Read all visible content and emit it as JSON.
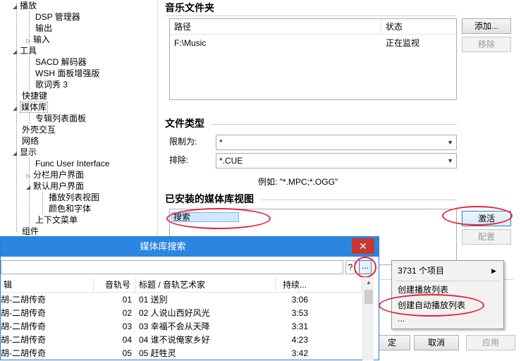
{
  "tree": {
    "items": [
      {
        "label": "播放"
      },
      {
        "label": "DSP 管理器"
      },
      {
        "label": "输出"
      },
      {
        "label": "输入"
      },
      {
        "label": "工具"
      },
      {
        "label": "SACD 解码器"
      },
      {
        "label": "WSH 面板增强版"
      },
      {
        "label": "歌词秀 3"
      },
      {
        "label": "快捷键"
      },
      {
        "label": "媒体库"
      },
      {
        "label": "专辑列表面板"
      },
      {
        "label": "外壳交互"
      },
      {
        "label": "网络"
      },
      {
        "label": "显示"
      },
      {
        "label": "Func User Interface"
      },
      {
        "label": "分栏用户界面"
      },
      {
        "label": "默认用户界面"
      },
      {
        "label": "播放列表视图"
      },
      {
        "label": "颜色和字体"
      },
      {
        "label": "上下文菜单"
      },
      {
        "label": "组件"
      }
    ]
  },
  "music_folders": {
    "title": "音乐文件夹",
    "col_path": "路径",
    "col_status": "状态",
    "rows": [
      {
        "path": "F:\\Music",
        "status": "正在监视"
      }
    ],
    "add_label": "添加...",
    "remove_label": "移除"
  },
  "file_types": {
    "title": "文件类型",
    "restrict_label": "限制为:",
    "restrict_value": "*",
    "exclude_label": "排除:",
    "exclude_value": "*.CUE",
    "example": "例如: \"*.MPC;*.OGG\""
  },
  "installed_views": {
    "title": "已安装的媒体库视图",
    "items": [
      "搜索"
    ],
    "activate_label": "激活",
    "configure_label": "配置"
  },
  "dialog_buttons": {
    "ok_label": "定",
    "cancel_label": "取消",
    "apply_label": "应用"
  },
  "search_window": {
    "title": "媒体库搜索",
    "close_glyph": "✕",
    "query_value": "",
    "help_label": "?",
    "more_label": "...",
    "columns": [
      "辑",
      "音轨号",
      "标题 / 音轨艺术家",
      "持续..."
    ],
    "rows": [
      {
        "album": "胡-二胡传奇",
        "track": "01",
        "title": "01 送别",
        "duration": "3:06"
      },
      {
        "album": "胡-二胡传奇",
        "track": "02",
        "title": "02 人说山西好风光",
        "duration": "3:53"
      },
      {
        "album": "胡-二胡传奇",
        "track": "03",
        "title": "03 幸福不会从天降",
        "duration": "3:31"
      },
      {
        "album": "胡-二胡传奇",
        "track": "04",
        "title": "04 谁不说俺家乡好",
        "duration": "4:23"
      },
      {
        "album": "胡-二胡传奇",
        "track": "05",
        "title": "05 赶牲灵",
        "duration": "3:42"
      }
    ]
  },
  "context_menu": {
    "count_label": "3731 个项目",
    "items": [
      "创建播放列表",
      "创建自动播放列表",
      "..."
    ]
  },
  "colors": {
    "titlebar": "#2b86e0",
    "close": "#c7372f",
    "highlight": "#e8233a",
    "selected_item": "#cde8ff"
  }
}
